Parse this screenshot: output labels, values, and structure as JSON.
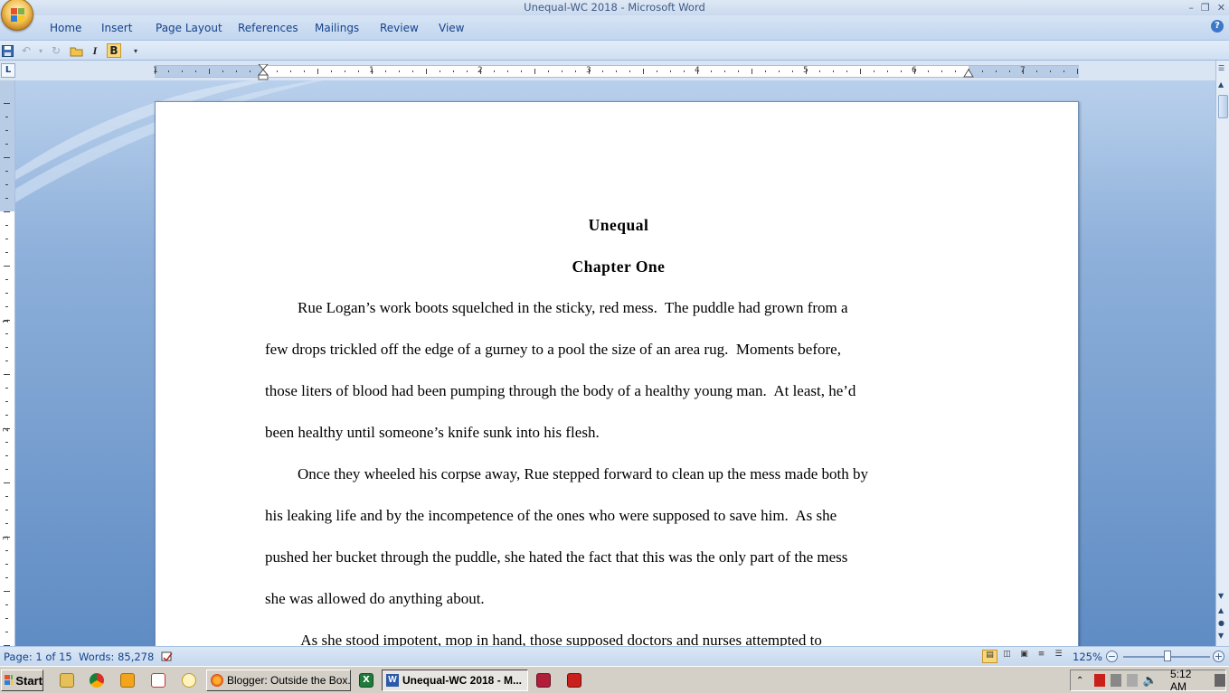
{
  "window": {
    "title": "Unequal-WC 2018 - Microsoft Word"
  },
  "ribbon": {
    "tabs": [
      "Home",
      "Insert",
      "Page Layout",
      "References",
      "Mailings",
      "Review",
      "View"
    ]
  },
  "ruler": {
    "tab_selector": "L",
    "h_numbers": [
      "1",
      "1",
      "2",
      "3",
      "4",
      "5",
      "6",
      "7"
    ],
    "v_numbers": [
      "1",
      "2",
      "3"
    ]
  },
  "document": {
    "title": "Unequal",
    "chapter": "Chapter One",
    "lines": [
      {
        "text": "Rue Logan’s work boots squelched in the sticky, red mess.  The puddle had grown from a",
        "indent": true
      },
      {
        "text": "few drops trickled off the edge of a gurney to a pool the size of an area rug.  Moments before,",
        "indent": false
      },
      {
        "text": "those liters of blood had been pumping through the body of a healthy young man.  At least, he’d",
        "indent": false
      },
      {
        "text": "been healthy until someone’s knife sunk into his flesh.",
        "indent": false
      },
      {
        "text": "Once they wheeled his corpse away, Rue stepped forward to clean up the mess made both by",
        "indent": true
      },
      {
        "text": "his leaking life and by the incompetence of the ones who were supposed to save him.  As she",
        "indent": false
      },
      {
        "text": "pushed her bucket through the puddle, she hated the fact that this was the only part of the mess",
        "indent": false
      },
      {
        "text": "she was allowed do anything about.",
        "indent": false
      },
      {
        "text": " As she stood impotent, mop in hand, those supposed doctors and nurses attempted to",
        "indent": true
      }
    ]
  },
  "status": {
    "page": "Page: 1 of 15",
    "words": "Words: 85,278",
    "zoom": "125%"
  },
  "taskbar": {
    "start": "Start",
    "tasks": [
      {
        "label": "Blogger: Outside the Box...",
        "active": false
      },
      {
        "label": "Unequal-WC 2018 - M...",
        "active": true
      }
    ],
    "clock": "5:12 AM"
  }
}
